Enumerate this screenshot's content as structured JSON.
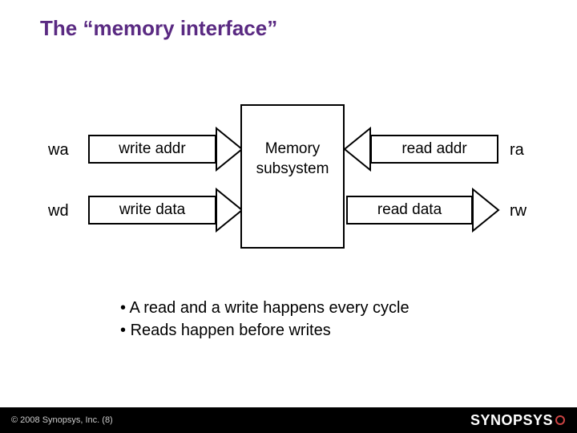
{
  "title": "The “memory interface”",
  "ports": {
    "wa": "wa",
    "wd": "wd",
    "ra": "ra",
    "rw": "rw"
  },
  "arrows": {
    "write_addr": "write addr",
    "write_data": "write data",
    "read_addr": "read addr",
    "read_data": "read data"
  },
  "memory": {
    "line1": "Memory",
    "line2": "subsystem"
  },
  "bullets": {
    "b1": "A read and a write happens every cycle",
    "b2": "Reads happen before writes"
  },
  "footer": {
    "copyright": "© 2008 Synopsys, Inc. (8)",
    "logo_text": "SYNOPSYS"
  },
  "colors": {
    "title": "#5a2a82",
    "footer_bg": "#000000"
  }
}
